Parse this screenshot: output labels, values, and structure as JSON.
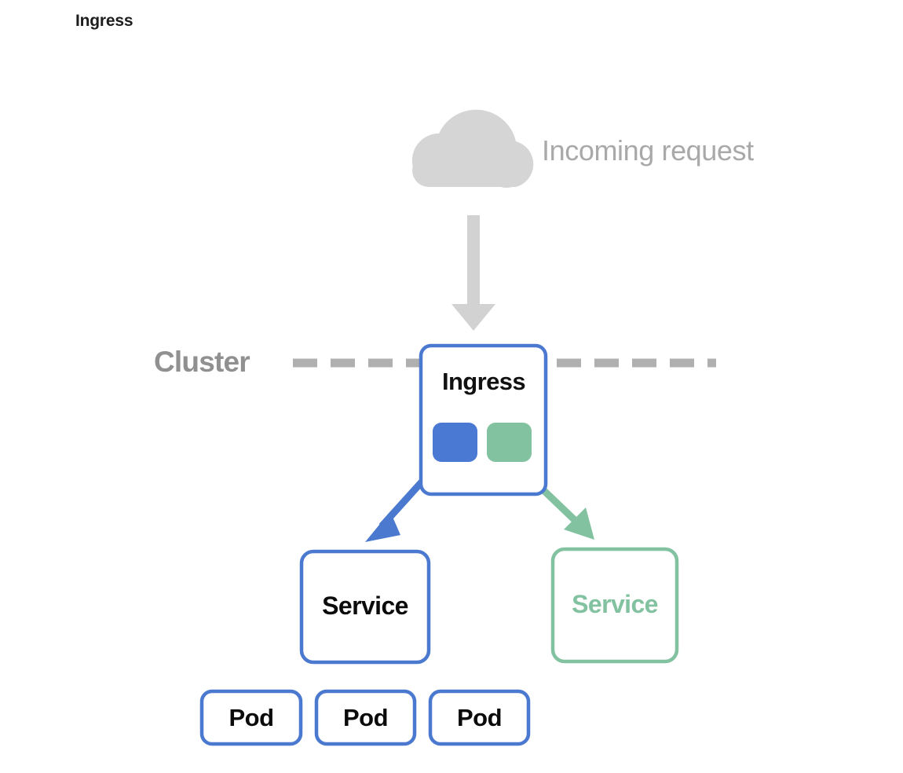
{
  "page": {
    "title": "Ingress",
    "background": "#ffffff"
  },
  "colors": {
    "blue": "#4a79cf",
    "blue_fill": "#4a79d4",
    "green": "#82c2a0",
    "gray_cloud": "#d5d5d5",
    "gray_arrow": "#d2d2d2",
    "gray_dash": "#b0b0b0",
    "gray_text": "#a9a9a9",
    "cluster_text": "#909090",
    "black_text": "#0b0b0b"
  },
  "source": {
    "cloud_icon": "cloud-icon",
    "label": "Incoming request",
    "arrow_icon": "arrow-down-icon"
  },
  "cluster": {
    "label": "Cluster",
    "boundary_icon": "dashed-boundary-line"
  },
  "ingress": {
    "label": "Ingress",
    "ports": [
      {
        "name": "ingress-port-blue",
        "color": "#4a79d4"
      },
      {
        "name": "ingress-port-green",
        "color": "#82c2a0"
      }
    ],
    "routes": [
      {
        "name": "route-arrow-blue",
        "color": "#4a79cf",
        "target": "Service"
      },
      {
        "name": "route-arrow-green",
        "color": "#82c2a0",
        "target": "Service"
      }
    ]
  },
  "services": [
    {
      "label": "Service",
      "color": "#4a79cf",
      "text_color": "#0b0b0b"
    },
    {
      "label": "Service",
      "color": "#82c2a0",
      "text_color": "#82c2a0"
    }
  ],
  "pods": [
    {
      "label": "Pod"
    },
    {
      "label": "Pod"
    },
    {
      "label": "Pod"
    }
  ]
}
